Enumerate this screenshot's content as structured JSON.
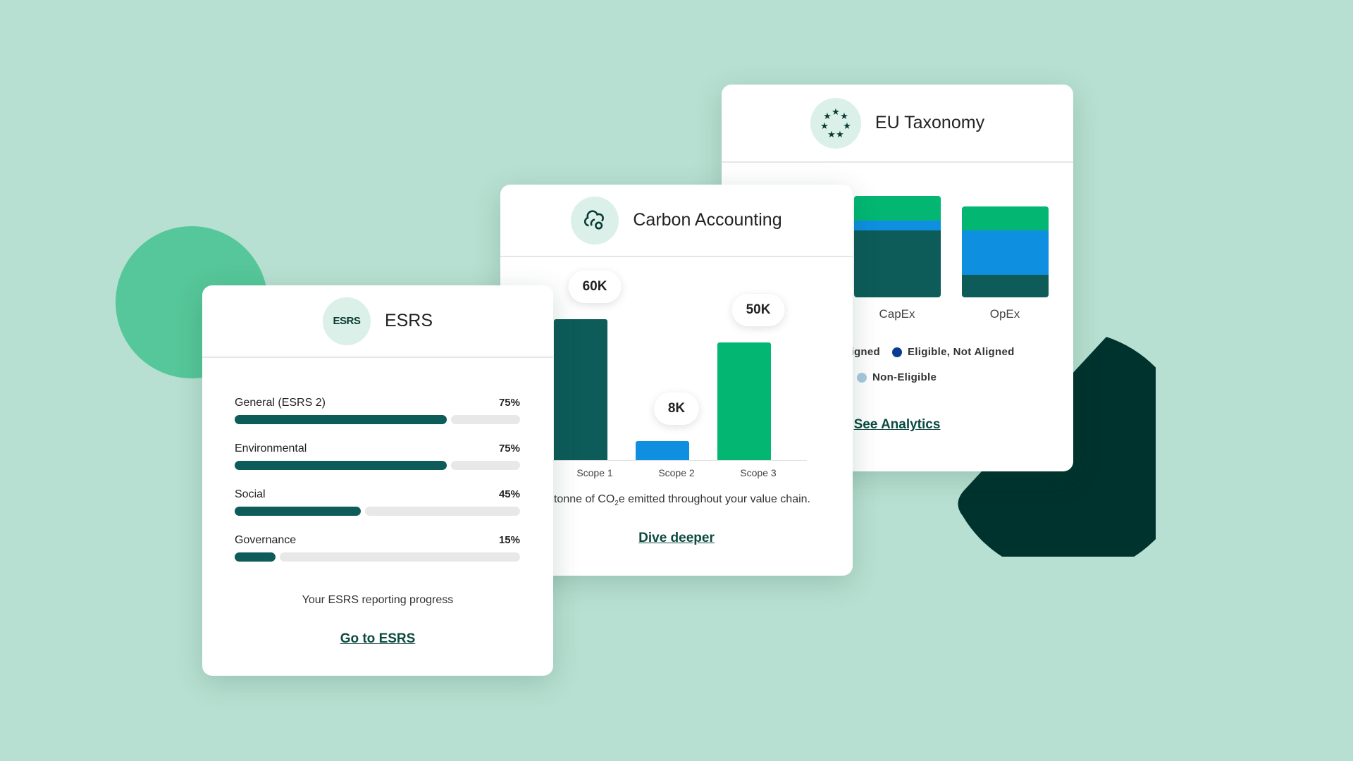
{
  "colors": {
    "background": "#b8e0d2",
    "dark_teal": "#0d5c5a",
    "blue": "#0f8fdf",
    "green": "#03b773",
    "deep": "#00332e",
    "eligible_not_aligned": "#0a3d91",
    "non_eligible": "#a9c9e0"
  },
  "eu": {
    "title": "EU Taxonomy",
    "icon": "eu-stars-icon",
    "link": "See Analytics",
    "legend": [
      {
        "label": "Aligned"
      },
      {
        "label": "Eligible, Not Aligned"
      },
      {
        "label": "Non-Eligible"
      }
    ]
  },
  "carbon": {
    "title": "Carbon Accounting",
    "icon": "cloud-icon",
    "caption_pre": "tonne of CO",
    "caption_sub": "2",
    "caption_post": "e emitted throughout your value chain.",
    "link": "Dive deeper"
  },
  "esrs": {
    "title": "ESRS",
    "icon_text": "ESRS",
    "caption": "Your ESRS reporting progress",
    "link": "Go to ESRS",
    "rows": [
      {
        "label": "General (ESRS 2)",
        "pct_text": "75%",
        "value": 75
      },
      {
        "label": "Environmental",
        "pct_text": "75%",
        "value": 75
      },
      {
        "label": "Social",
        "pct_text": "45%",
        "value": 45
      },
      {
        "label": "Governance",
        "pct_text": "15%",
        "value": 15
      }
    ]
  },
  "chart_data": [
    {
      "type": "bar",
      "categories": [
        "Scope 1",
        "Scope 2",
        "Scope 3"
      ],
      "values": [
        60000,
        8000,
        50000
      ],
      "data_labels": [
        "60K",
        "8K",
        "50K"
      ],
      "colors": [
        "#0d5c5a",
        "#0f8fdf",
        "#03b773"
      ]
    },
    {
      "type": "bar",
      "stacked": true,
      "categories": [
        "CapEx",
        "OpEx"
      ],
      "series": [
        {
          "name": "Aligned",
          "color": "#03b773",
          "values": [
            24,
            26
          ]
        },
        {
          "name": "Eligible, Not Aligned",
          "color": "#0f8fdf",
          "values": [
            10,
            49
          ]
        },
        {
          "name": "Non-Eligible",
          "color": "#0d5c5a",
          "values": [
            66,
            25
          ]
        }
      ]
    }
  ]
}
